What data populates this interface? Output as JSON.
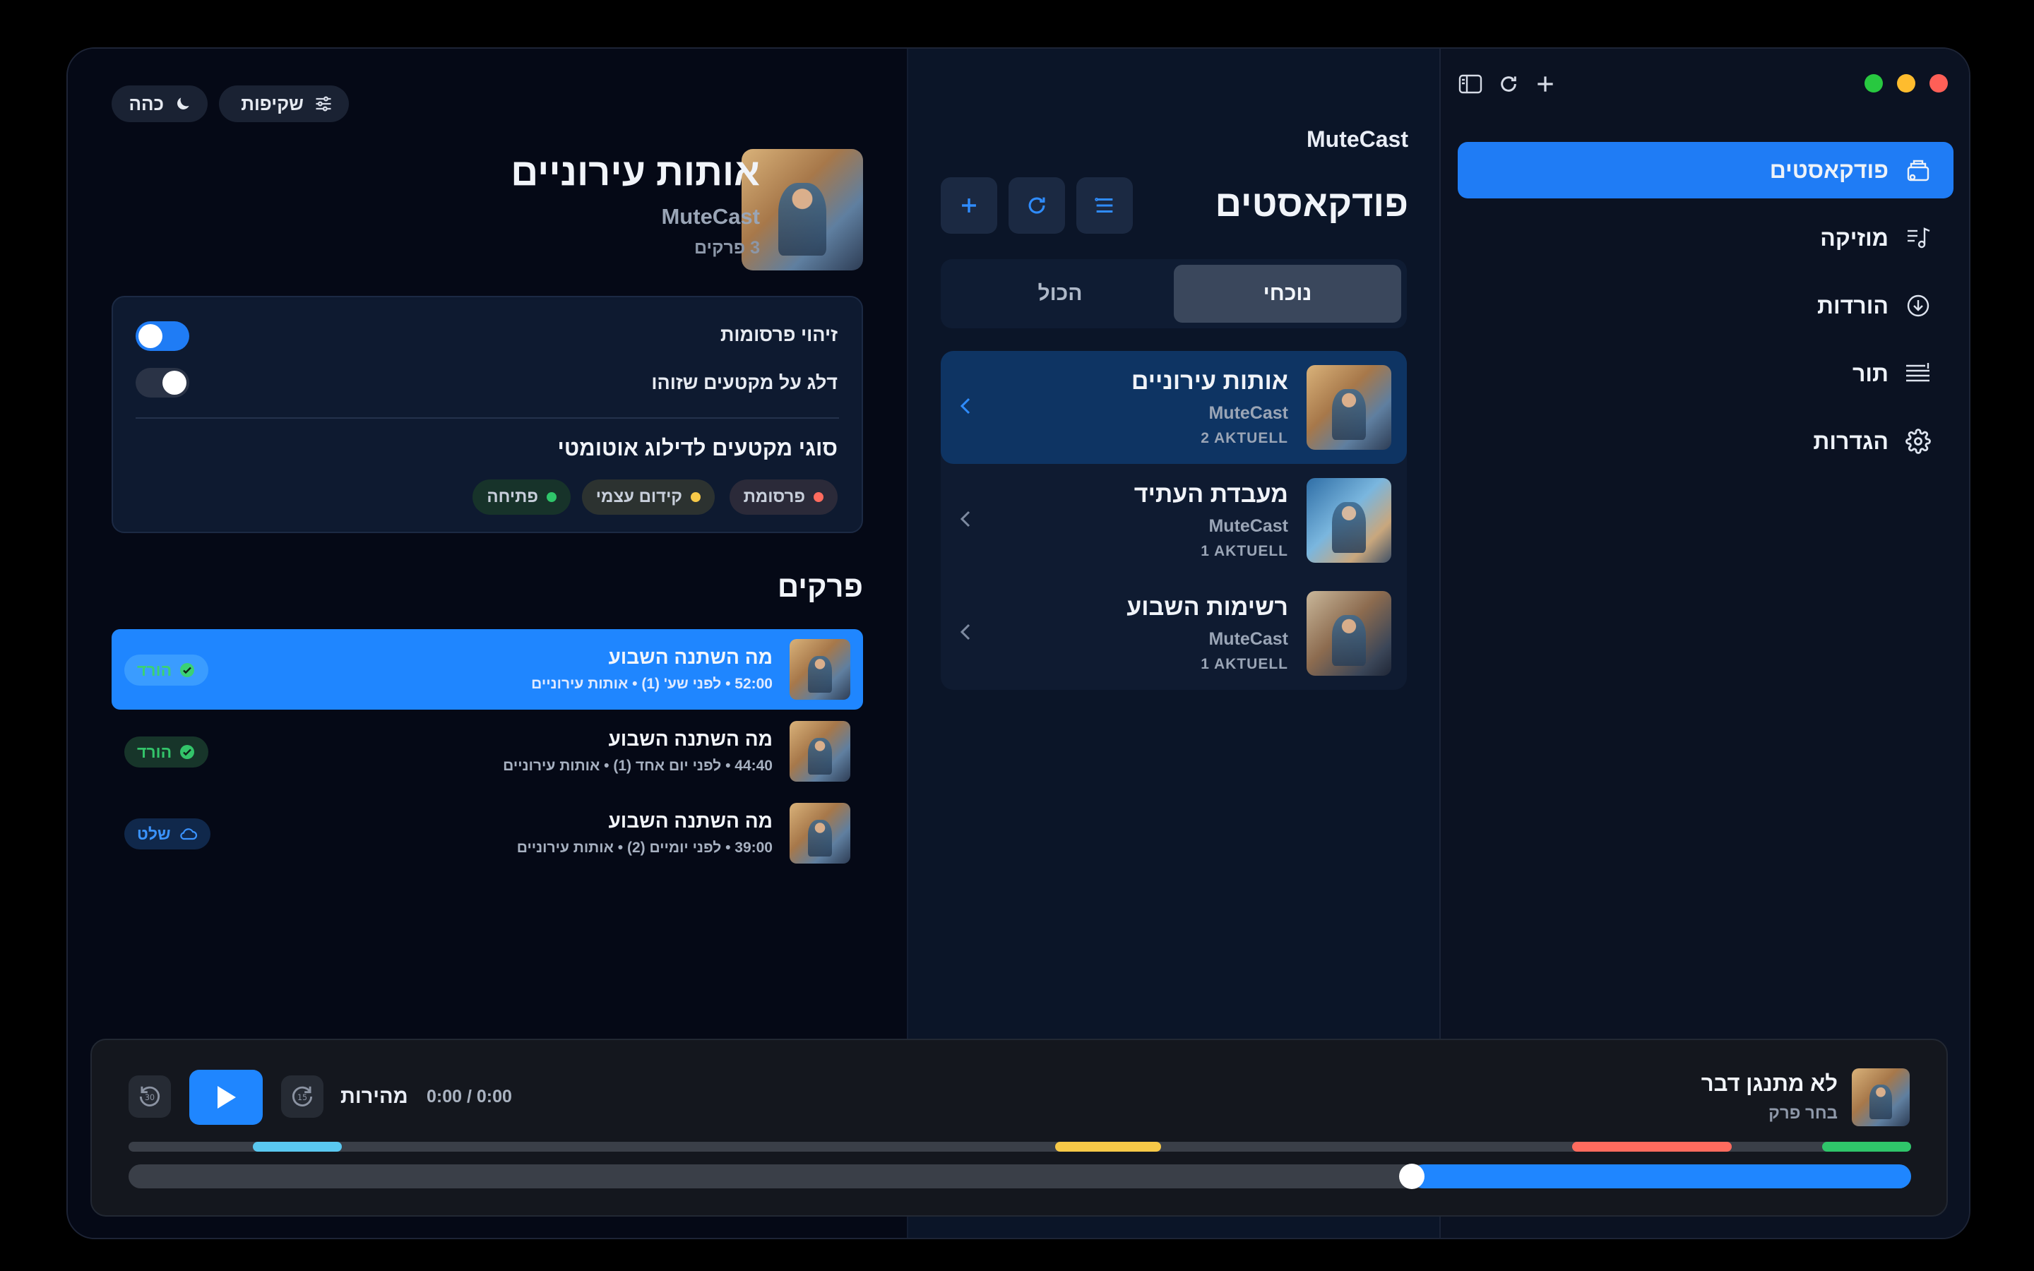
{
  "app": {
    "name": "MuteCast"
  },
  "window": {
    "traffic_lights": [
      "#ff5f57",
      "#febc2e",
      "#28c840"
    ]
  },
  "sidebar": {
    "items": [
      {
        "label": "פודקאסטים",
        "icon": "podcast-library-icon",
        "active": true
      },
      {
        "label": "מוזיקה",
        "icon": "music-note-icon",
        "active": false
      },
      {
        "label": "הורדות",
        "icon": "download-circle-icon",
        "active": false
      },
      {
        "label": "תור",
        "icon": "queue-list-icon",
        "active": false
      },
      {
        "label": "הגדרות",
        "icon": "gear-icon",
        "active": false
      }
    ]
  },
  "list": {
    "app_label": "MuteCast",
    "title": "פודקאסטים",
    "segments": {
      "current": "נוכחי",
      "all": "הכול",
      "selected": "current"
    },
    "podcasts": [
      {
        "name": "אותות עירוניים",
        "author": "MuteCast",
        "count": "2 AKTUELL",
        "selected": true
      },
      {
        "name": "מעבדת העתיד",
        "author": "MuteCast",
        "count": "1 AKTUELL",
        "selected": false
      },
      {
        "name": "רשימות השבוע",
        "author": "MuteCast",
        "count": "1 AKTUELL",
        "selected": false
      }
    ]
  },
  "detail": {
    "top_buttons": {
      "transparency": "שקיפות",
      "dark": "כהה"
    },
    "title": "אותות עירוניים",
    "author": "MuteCast",
    "episode_count": "3 פרקים",
    "settings": {
      "ad_detection_label": "זיהוי פרסומות",
      "ad_detection_on": true,
      "skip_label": "דלג על מקטעים שזוהו",
      "skip_on": false,
      "segments_title": "סוגי מקטעים לדילוג אוטומטי",
      "chips": [
        {
          "label": "פרסומת",
          "color": "#ff6b5e"
        },
        {
          "label": "קידום עצמי",
          "color": "#f7c948"
        },
        {
          "label": "פתיחה",
          "color": "#2fc56a"
        }
      ]
    },
    "episodes_title": "פרקים",
    "episodes": [
      {
        "title": "מה השתנה השבוע",
        "meta": "52:00 • לפני שע' (1) • אותות עירוניים",
        "badge": "הורד",
        "badge_type": "downloaded",
        "selected": true
      },
      {
        "title": "מה השתנה השבוע",
        "meta": "44:40 • לפני יום אחד (1) • אותות עירוניים",
        "badge": "הורד",
        "badge_type": "downloaded",
        "selected": false
      },
      {
        "title": "מה השתנה השבוע",
        "meta": "39:00 • לפני יומיים (2) • אותות עירוניים",
        "badge": "שלט",
        "badge_type": "cloud",
        "selected": false
      }
    ]
  },
  "player": {
    "title": "לא מתנגן דבר",
    "subtitle": "בחר פרק",
    "speed_label": "מהירות",
    "time": "0:00 / 0:00",
    "skip_back": "30",
    "skip_forward": "15",
    "progress": 0.28,
    "segment_colors": {
      "cyan": "#5ac8f0",
      "yellow": "#f7c948",
      "red": "#ff6b5e",
      "green": "#2fc56a"
    }
  }
}
